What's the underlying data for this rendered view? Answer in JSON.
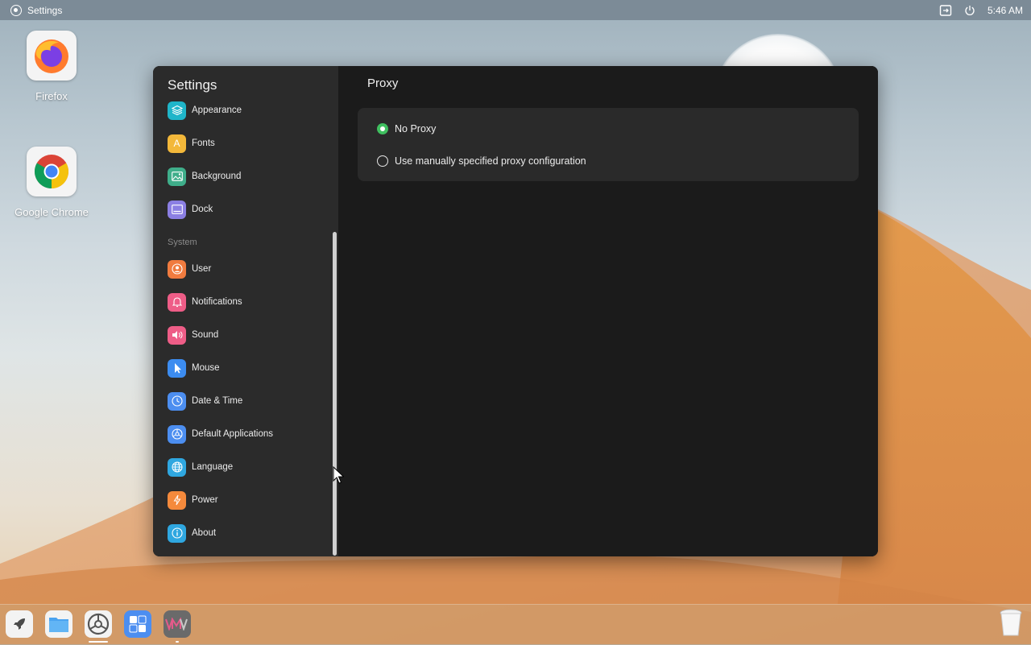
{
  "topbar": {
    "app_name": "Settings",
    "time": "5:46 AM"
  },
  "desktop": {
    "icons": [
      {
        "label": "Firefox"
      },
      {
        "label": "Google Chrome"
      }
    ]
  },
  "window": {
    "sidebar_title": "Settings",
    "page_title": "Proxy",
    "section_system": "System",
    "nav_items": [
      {
        "label": "Appearance",
        "icon": "layers-icon",
        "color": "#1fb5c9"
      },
      {
        "label": "Fonts",
        "icon": "font-icon",
        "color": "#f3b83a"
      },
      {
        "label": "Background",
        "icon": "image-icon",
        "color": "#3fae8a"
      },
      {
        "label": "Dock",
        "icon": "dock-icon",
        "color": "#8b7fe3"
      },
      {
        "label": "User",
        "icon": "user-icon",
        "color": "#f07b3f"
      },
      {
        "label": "Notifications",
        "icon": "bell-icon",
        "color": "#ee5d87"
      },
      {
        "label": "Sound",
        "icon": "speaker-icon",
        "color": "#ee5d87"
      },
      {
        "label": "Mouse",
        "icon": "pointer-icon",
        "color": "#3c8cf0"
      },
      {
        "label": "Date & Time",
        "icon": "clock-icon",
        "color": "#4c8ef0"
      },
      {
        "label": "Default Applications",
        "icon": "apps-icon",
        "color": "#4c8ef0"
      },
      {
        "label": "Language",
        "icon": "globe-icon",
        "color": "#2fa7e0"
      },
      {
        "label": "Power",
        "icon": "bolt-icon",
        "color": "#f58a3c"
      },
      {
        "label": "About",
        "icon": "info-icon",
        "color": "#2fa7e0"
      }
    ],
    "proxy_options": [
      {
        "label": "No Proxy",
        "selected": true
      },
      {
        "label": "Use manually specified proxy configuration",
        "selected": false
      }
    ],
    "accent_color": "#3fbf5f"
  },
  "dock": {
    "items": [
      "launcher-icon",
      "files-icon",
      "settings-icon",
      "calculator-icon",
      "vm-icon",
      "trash-icon"
    ]
  }
}
